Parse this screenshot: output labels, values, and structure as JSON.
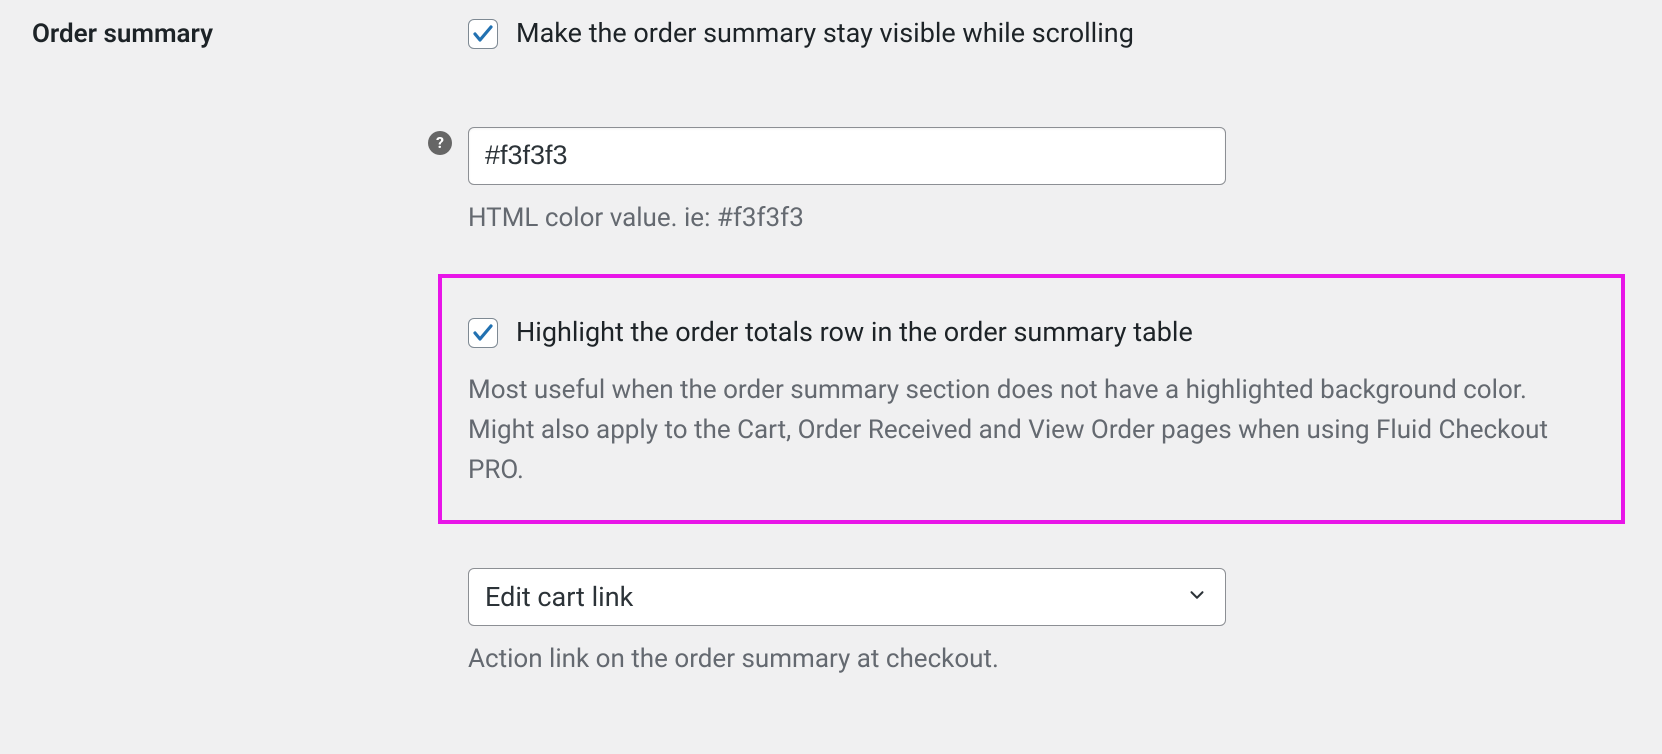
{
  "section": {
    "label": "Order summary"
  },
  "sticky": {
    "label": "Make the order summary stay visible while scrolling",
    "checked": true
  },
  "color": {
    "value": "#f3f3f3",
    "description": "HTML color value. ie: #f3f3f3"
  },
  "highlight": {
    "label": "Highlight the order totals row in the order summary table",
    "description": "Most useful when the order summary section does not have a highlighted background color. Might also apply to the Cart, Order Received and View Order pages when using Fluid Checkout PRO.",
    "checked": true
  },
  "action_link": {
    "selected": "Edit cart link",
    "description": "Action link on the order summary at checkout."
  },
  "help_tooltip": "?"
}
